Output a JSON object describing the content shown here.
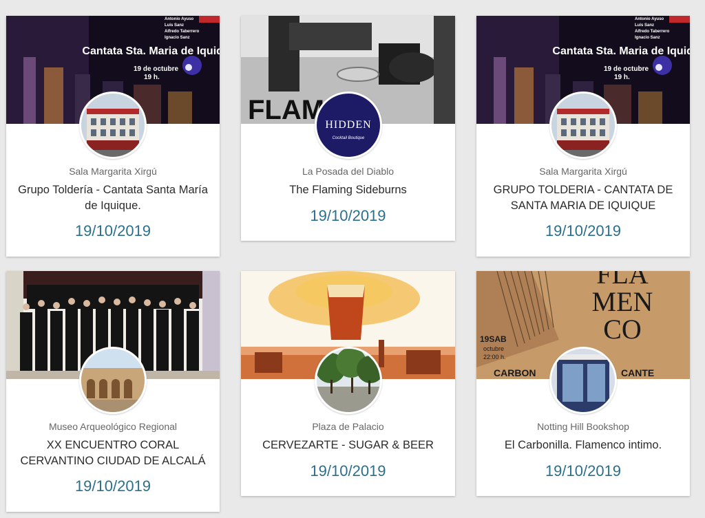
{
  "cards": [
    {
      "venue": "Sala Margarita Xirgú",
      "title": "Grupo Toldería - Cantata Santa María de Iquique.",
      "date": "19/10/2019",
      "banner": {
        "names": [
          "Antonio Ayuso",
          "Luis Sanz",
          "Alfredo Taberrero",
          "Ignacio Sanz"
        ],
        "headline": "Cantata Sta. Maria de Iquique",
        "date_line": "19 de octubre",
        "time_line": "19 h."
      },
      "avatar_icon": "building-photo-icon"
    },
    {
      "venue": "La Posada del Diablo",
      "title": "The Flaming Sideburns",
      "date": "19/10/2019",
      "banner": {
        "text": "FLAMING"
      },
      "avatar": {
        "logo_text": "HIDDEN",
        "logo_sub": "Cocktail Boutique"
      },
      "avatar_icon": "hidden-logo-icon"
    },
    {
      "venue": "Sala Margarita Xirgú",
      "title": "GRUPO TOLDERIA - CANTATA DE SANTA MARIA DE IQUIQUE",
      "date": "19/10/2019",
      "banner": {
        "names": [
          "Antonio Ayuso",
          "Luis Sanz",
          "Alfredo Taberrero",
          "Ignacio Sanz"
        ],
        "headline": "Cantata Sta. Maria de Iquique",
        "date_line": "19 de octubre",
        "time_line": "19 h."
      },
      "avatar_icon": "building-photo-icon"
    },
    {
      "venue": "Museo Arqueológico Regional",
      "title": "XX ENCUENTRO CORAL CERVANTINO CIUDAD DE ALCALÁ",
      "date": "19/10/2019",
      "avatar_icon": "cloister-photo-icon"
    },
    {
      "venue": "Plaza de Palacio",
      "title": "CERVEZARTE - SUGAR & BEER",
      "date": "19/10/2019",
      "avatar_icon": "plaza-photo-icon"
    },
    {
      "venue": "Notting Hill Bookshop",
      "title": "El Carbonilla. Flamenco intimo.",
      "date": "19/10/2019",
      "banner": {
        "lines": [
          "FLA",
          "MEN",
          "CO"
        ],
        "day": "19SAB",
        "month": "octubre",
        "time": "22:00 h.",
        "bottom_left": "CARBON",
        "bottom_right": "CANTE"
      },
      "avatar_icon": "bookshop-photo-icon"
    }
  ],
  "colors": {
    "date": "#2a6f8c",
    "venue": "#666666",
    "title": "#2b2b2b",
    "background": "#e9e9e9"
  }
}
